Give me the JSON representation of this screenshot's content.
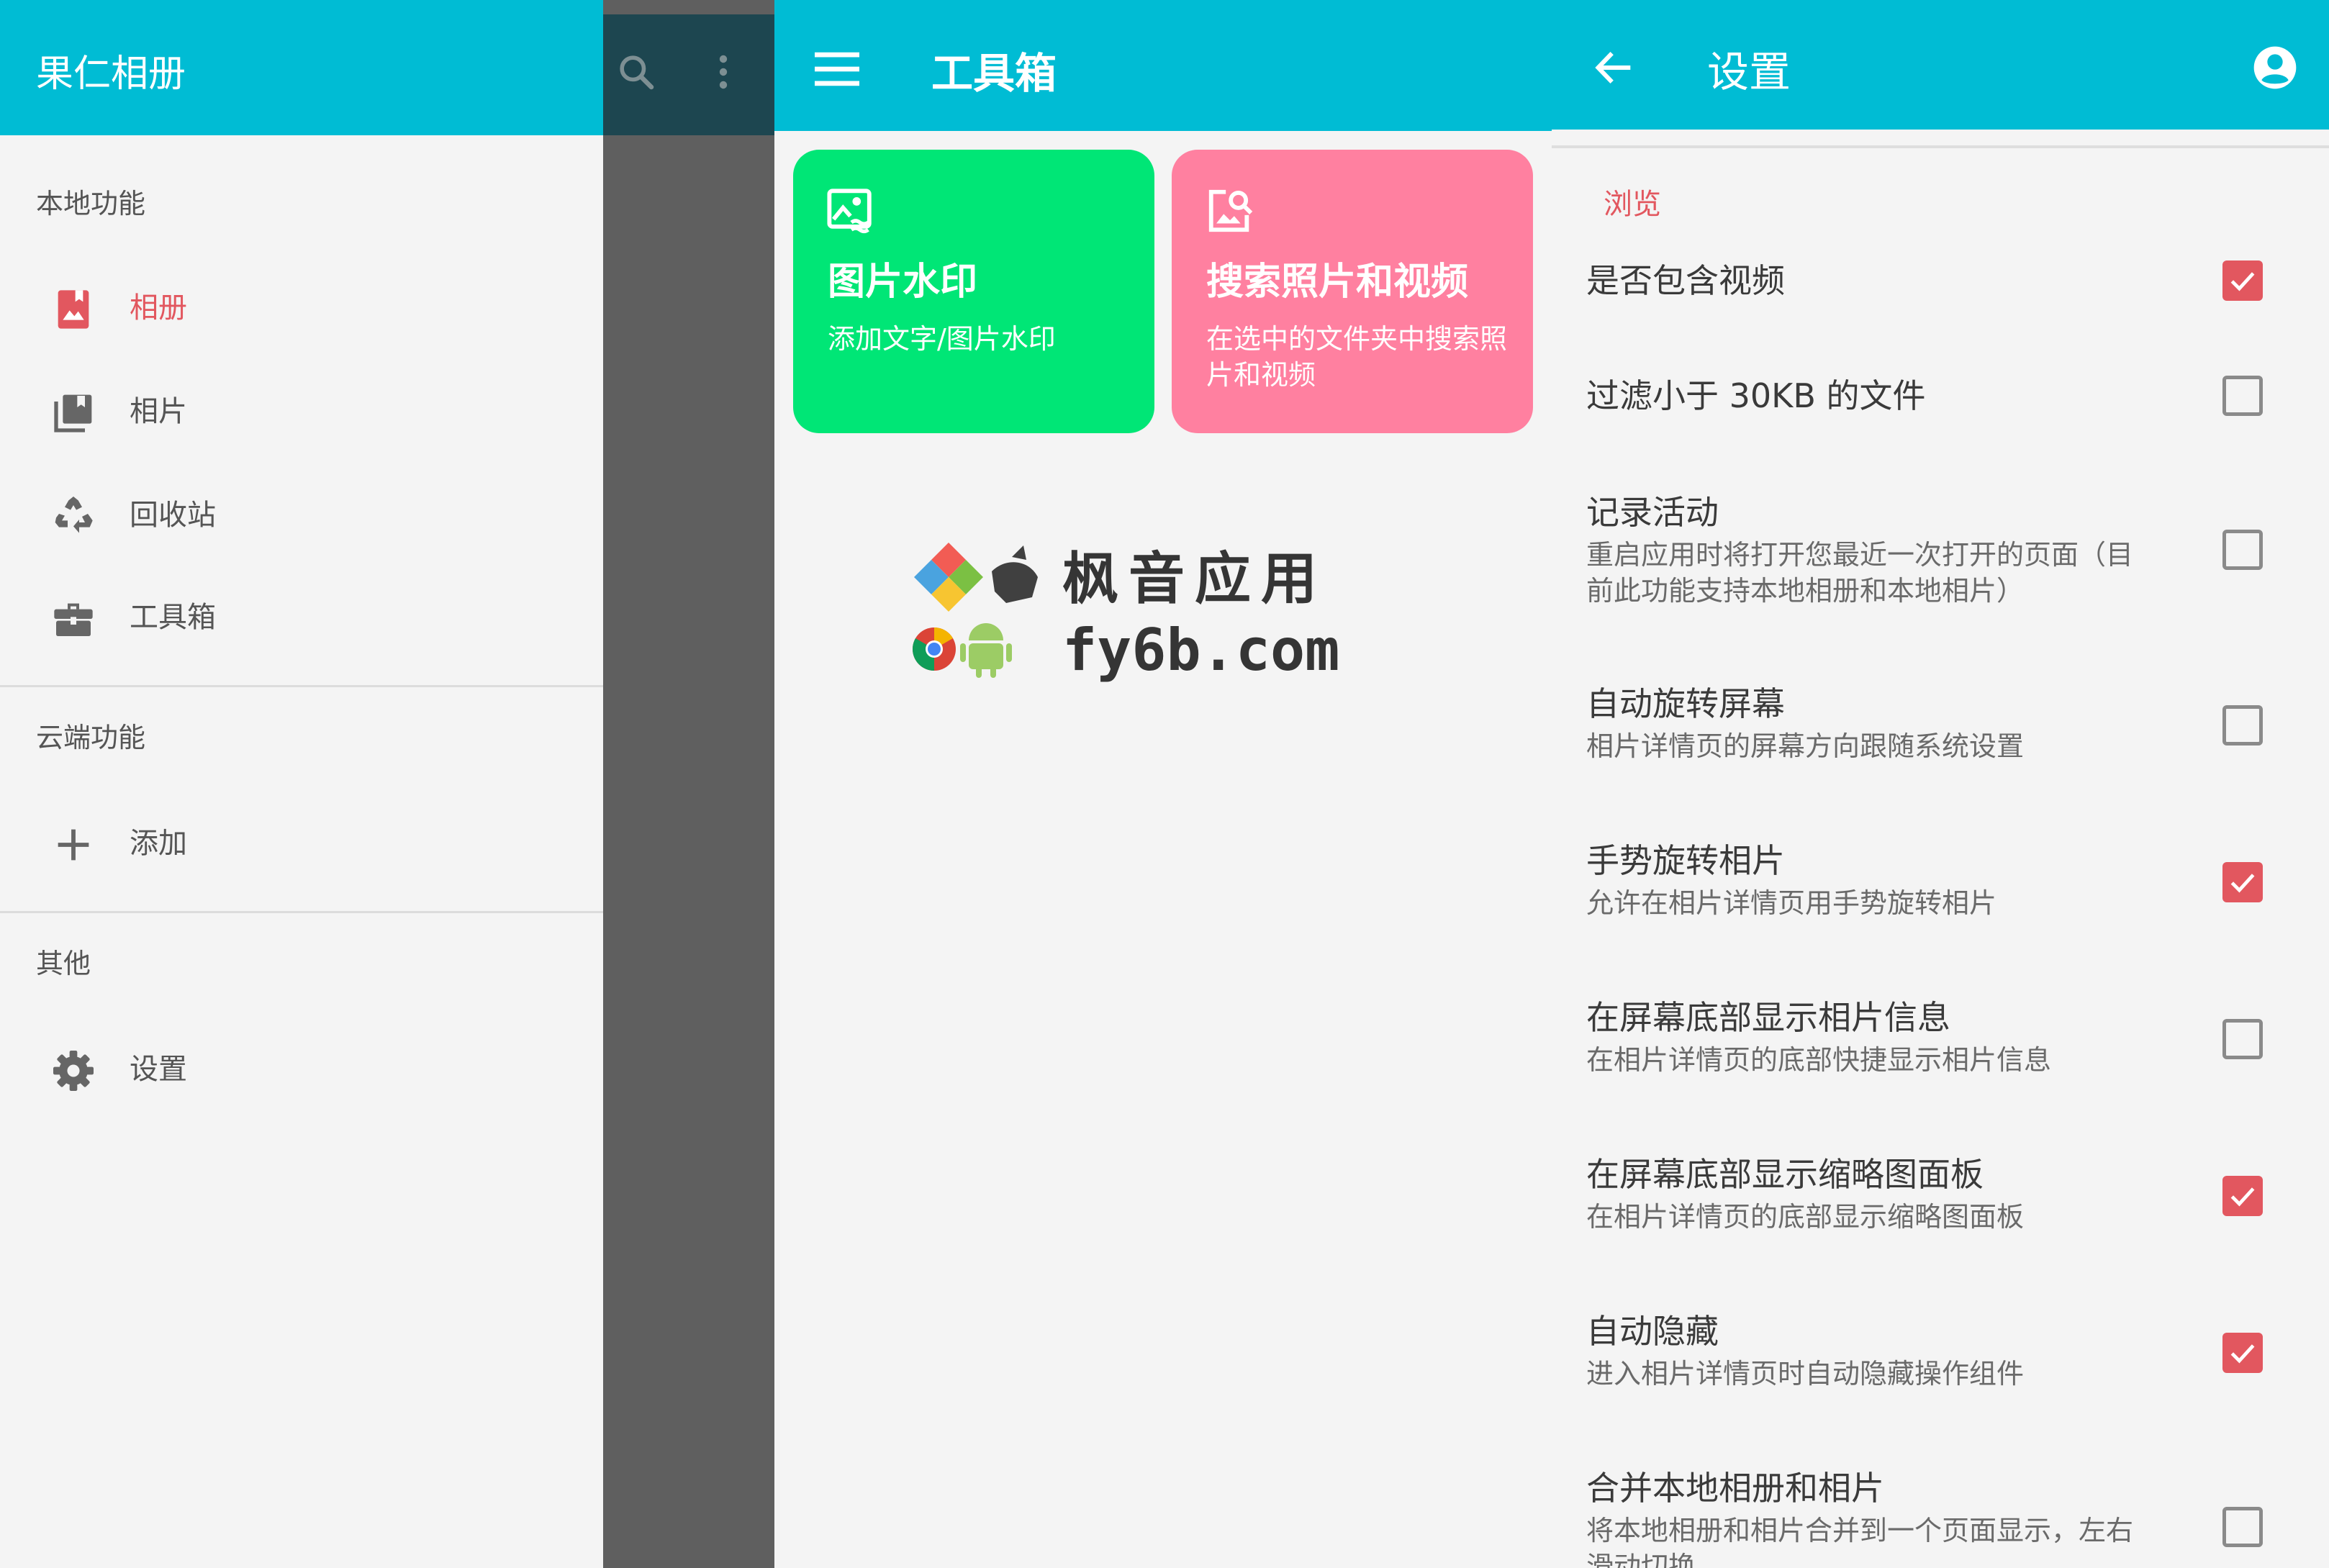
{
  "colors": {
    "appbar": "#00bcd4",
    "accent": "#e2575f",
    "card_green": "#00e676",
    "card_pink": "#ff80a0",
    "scrim": "#5f5f5f"
  },
  "drawer": {
    "app_title": "果仁相册",
    "sections": {
      "local": "本地功能",
      "cloud": "云端功能",
      "other": "其他"
    },
    "items": [
      {
        "label": "相册",
        "icon": "album-icon",
        "active": true
      },
      {
        "label": "相片",
        "icon": "photos-library-icon",
        "active": false
      },
      {
        "label": "回收站",
        "icon": "recycle-icon",
        "active": false
      },
      {
        "label": "工具箱",
        "icon": "toolbox-icon",
        "active": false
      },
      {
        "label": "添加",
        "icon": "plus-icon",
        "active": false
      },
      {
        "label": "设置",
        "icon": "gear-icon",
        "active": false
      }
    ]
  },
  "toolbox": {
    "title": "工具箱",
    "cards": [
      {
        "title": "图片水印",
        "subtitle": "添加文字/图片水印",
        "icon": "image-watermark-icon"
      },
      {
        "title": "搜索照片和视频",
        "subtitle": "在选中的文件夹中搜索照片和视频",
        "icon": "image-search-icon"
      }
    ]
  },
  "watermark": {
    "line1": "枫音应用",
    "line2": "fy6b.com"
  },
  "settings": {
    "title": "设置",
    "category": "浏览",
    "prefs": [
      {
        "title": "是否包含视频",
        "summary": "",
        "checked": true
      },
      {
        "title": "过滤小于 30KB 的文件",
        "summary": "",
        "checked": false
      },
      {
        "title": "记录活动",
        "summary": "重启应用时将打开您最近一次打开的页面（目前此功能支持本地相册和本地相片）",
        "checked": false
      },
      {
        "title": "自动旋转屏幕",
        "summary": "相片详情页的屏幕方向跟随系统设置",
        "checked": false
      },
      {
        "title": "手势旋转相片",
        "summary": "允许在相片详情页用手势旋转相片",
        "checked": true
      },
      {
        "title": "在屏幕底部显示相片信息",
        "summary": "在相片详情页的底部快捷显示相片信息",
        "checked": false
      },
      {
        "title": "在屏幕底部显示缩略图面板",
        "summary": "在相片详情页的底部显示缩略图面板",
        "checked": true
      },
      {
        "title": "自动隐藏",
        "summary": "进入相片详情页时自动隐藏操作组件",
        "checked": true
      },
      {
        "title": "合并本地相册和相片",
        "summary": "将本地相册和相片合并到一个页面显示，左右滑动切换",
        "checked": false
      }
    ]
  }
}
